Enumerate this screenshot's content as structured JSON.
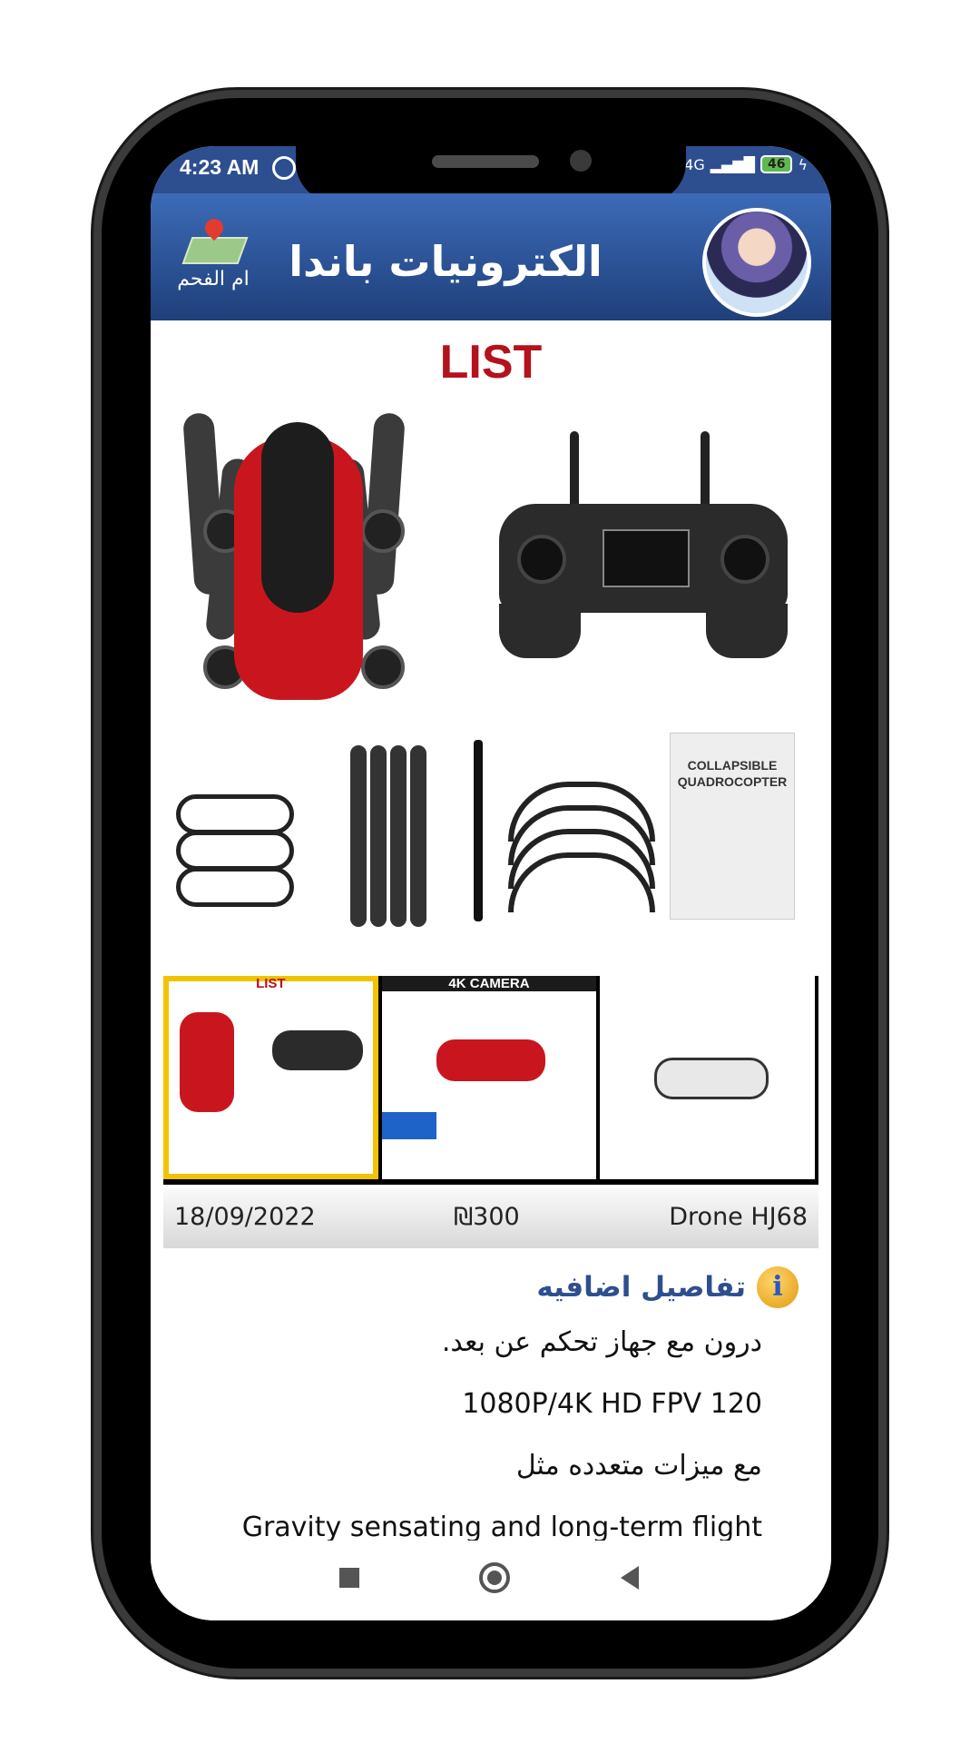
{
  "status_bar": {
    "time": "4:23 AM",
    "network": "4G",
    "battery": "46"
  },
  "header": {
    "title": "الكترونيات باندا",
    "location_label": "ام الفحم"
  },
  "product_image": {
    "heading": "LIST",
    "manual_text": "COLLAPSIBLE QUADROCOPTER"
  },
  "thumbnails": [
    {
      "caption": "LIST",
      "selected": true
    },
    {
      "caption": "4K CAMERA",
      "selected": false
    },
    {
      "caption": "",
      "selected": false
    }
  ],
  "info_bar": {
    "date": "18/09/2022",
    "price": "₪300",
    "name": "Drone  HJ68"
  },
  "details": {
    "title": "تفاصيل اضافيه",
    "lines": [
      "درون مع جهاز تحكم عن بعد.",
      "1080P/4K HD FPV 120",
      "مع ميزات متعدده مثل",
      "Gravity sensating and long-term flight"
    ]
  },
  "colors": {
    "header": "#2d4f8f",
    "accent_red": "#b4121c",
    "thumb_selected": "#f2c200"
  }
}
